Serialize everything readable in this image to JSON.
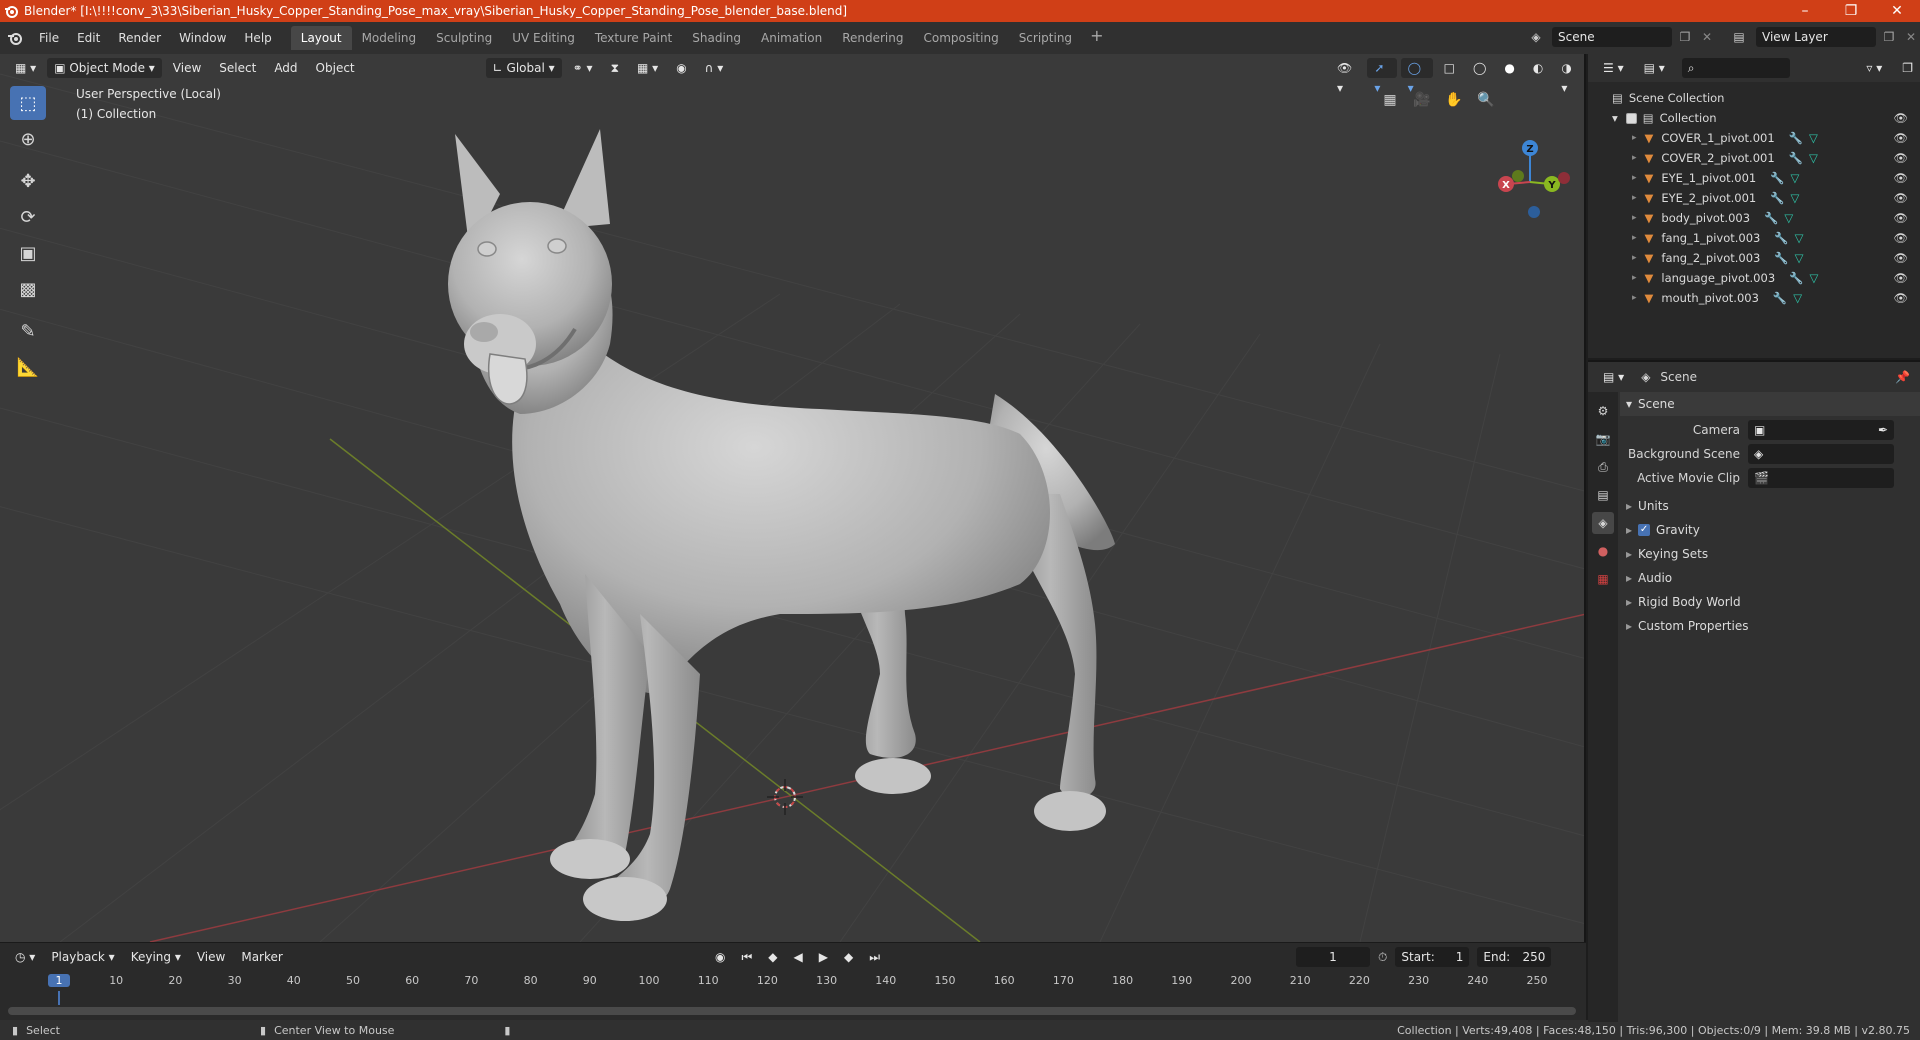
{
  "title_bar": {
    "title": "Blender* [I:\\!!!!conv_3\\33\\Siberian_Husky_Copper_Standing_Pose_max_vray\\Siberian_Husky_Copper_Standing_Pose_blender_base.blend]"
  },
  "menu": [
    "File",
    "Edit",
    "Render",
    "Window",
    "Help"
  ],
  "workspaces": [
    "Layout",
    "Modeling",
    "Sculpting",
    "UV Editing",
    "Texture Paint",
    "Shading",
    "Animation",
    "Rendering",
    "Compositing",
    "Scripting"
  ],
  "active_workspace": "Layout",
  "scene_selector": "Scene",
  "view_layer": "View Layer",
  "viewport": {
    "mode": "Object Mode",
    "menus": [
      "View",
      "Select",
      "Add",
      "Object"
    ],
    "orientation": "Global",
    "info_line1": "User Perspective (Local)",
    "info_line2": "(1) Collection",
    "gizmo": {
      "x": "X",
      "y": "Y",
      "z": "Z"
    }
  },
  "outliner": {
    "root": "Scene Collection",
    "collection": "Collection",
    "items": [
      "COVER_1_pivot.001",
      "COVER_2_pivot.001",
      "EYE_1_pivot.001",
      "EYE_2_pivot.001",
      "body_pivot.003",
      "fang_1_pivot.003",
      "fang_2_pivot.003",
      "language_pivot.003",
      "mouth_pivot.003"
    ]
  },
  "properties": {
    "context": "Scene",
    "section": "Scene",
    "fields": [
      {
        "label": "Camera"
      },
      {
        "label": "Background Scene"
      },
      {
        "label": "Active Movie Clip"
      }
    ],
    "subsections": [
      "Units",
      "Gravity",
      "Keying Sets",
      "Audio",
      "Rigid Body World",
      "Custom Properties"
    ]
  },
  "timeline": {
    "menus": [
      "Playback",
      "Keying",
      "View",
      "Marker"
    ],
    "current_frame": "1",
    "start_label": "Start:",
    "start": "1",
    "end_label": "End:",
    "end": "250",
    "ticks": [
      "1",
      "10",
      "20",
      "30",
      "40",
      "50",
      "60",
      "70",
      "80",
      "90",
      "100",
      "110",
      "120",
      "130",
      "140",
      "150",
      "160",
      "170",
      "180",
      "190",
      "200",
      "210",
      "220",
      "230",
      "240",
      "250"
    ]
  },
  "status": {
    "select": "Select",
    "center_view": "Center View to Mouse",
    "stats": "Collection | Verts:49,408 | Faces:48,150 | Tris:96,300 | Objects:0/9 | Mem: 39.8 MB | v2.80.75"
  },
  "colors": {
    "titlebar": "#d03f17",
    "accent": "#4772b3",
    "viewport_bg": "#3a3a3a",
    "x_axis": "#c8454f",
    "y_axis": "#8ab821",
    "z_axis": "#3d86d6"
  }
}
